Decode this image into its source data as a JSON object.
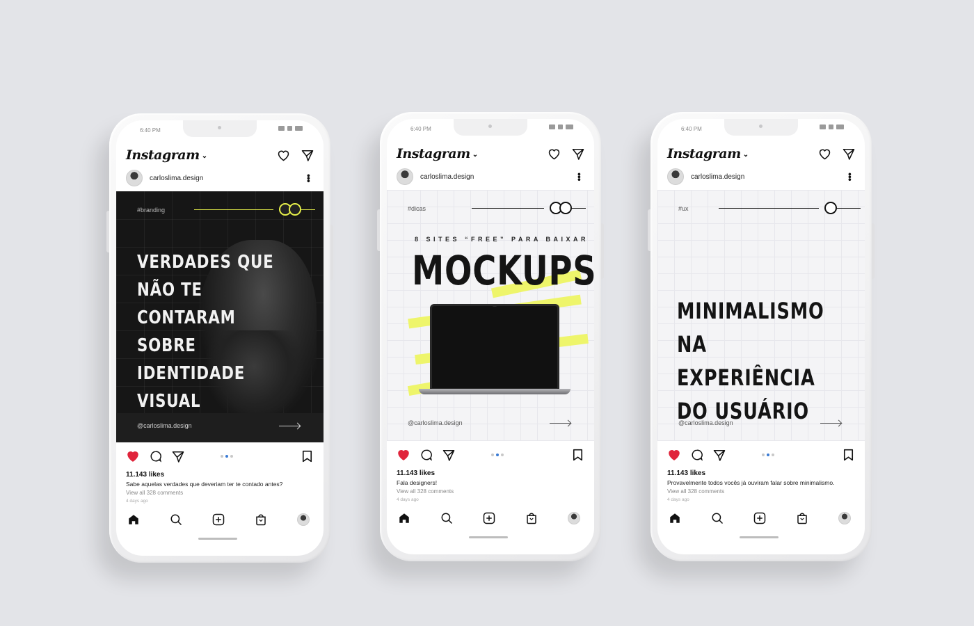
{
  "phones": [
    {
      "status_time": "6:40 PM",
      "app_name": "Instagram",
      "username": "carloslima.design",
      "post": {
        "theme": "dark",
        "tag": "#branding",
        "subhead": "",
        "headline": "VERDADES QUE NÃO TE CONTARAM SOBRE IDENTIDADE VISUAL",
        "headline_lines": [
          "VERDADES QUE",
          "NÃO TE CONTARAM",
          "SOBRE",
          "IDENTIDADE",
          "VISUAL"
        ],
        "handle": "@carloslima.design",
        "accent": "#e6f04a"
      },
      "likes": "11.143 likes",
      "caption": "Sabe aquelas verdades que deveriam ter te contado antes?",
      "comments": "View all 328 comments",
      "ago": "4 days ago",
      "carousel": {
        "count": 3,
        "active": 1
      }
    },
    {
      "status_time": "6:40 PM",
      "app_name": "Instagram",
      "username": "carloslima.design",
      "post": {
        "theme": "light",
        "tag": "#dicas",
        "subhead": "8 SITES “FREE” PARA BAIXAR",
        "headline": "MOCKUPS",
        "headline_lines": [
          "MOCKUPS"
        ],
        "handle": "@carloslima.design",
        "accent": "#eef56b"
      },
      "likes": "11.143 likes",
      "caption": "Fala designers!",
      "comments": "View all 328 comments",
      "ago": "4 days ago",
      "carousel": {
        "count": 3,
        "active": 1
      }
    },
    {
      "status_time": "6:40 PM",
      "app_name": "Instagram",
      "username": "carloslima.design",
      "post": {
        "theme": "light",
        "tag": "#ux",
        "subhead": "",
        "headline": "MINIMALISMO NA EXPERIÊNCIA DO USUÁRIO",
        "headline_lines": [
          "MINIMALISMO",
          "NA EXPERIÊNCIA",
          "DO USUÁRIO"
        ],
        "handle": "@carloslima.design",
        "accent": "#111111"
      },
      "likes": "11.143 likes",
      "caption": "Provavelmente todos vocês já ouviram falar sobre minimalismo.",
      "comments": "View all 328 comments",
      "ago": "4 days ago",
      "carousel": {
        "count": 3,
        "active": 1
      }
    }
  ],
  "icons": {
    "header": [
      "heart-icon",
      "send-icon"
    ],
    "actions": [
      "heart-filled-icon",
      "comment-icon",
      "send-icon",
      "bookmark-icon"
    ],
    "bottom_nav": [
      "home-icon",
      "search-icon",
      "add-icon",
      "shop-icon",
      "profile-avatar"
    ],
    "like_color": "#e0243b"
  }
}
